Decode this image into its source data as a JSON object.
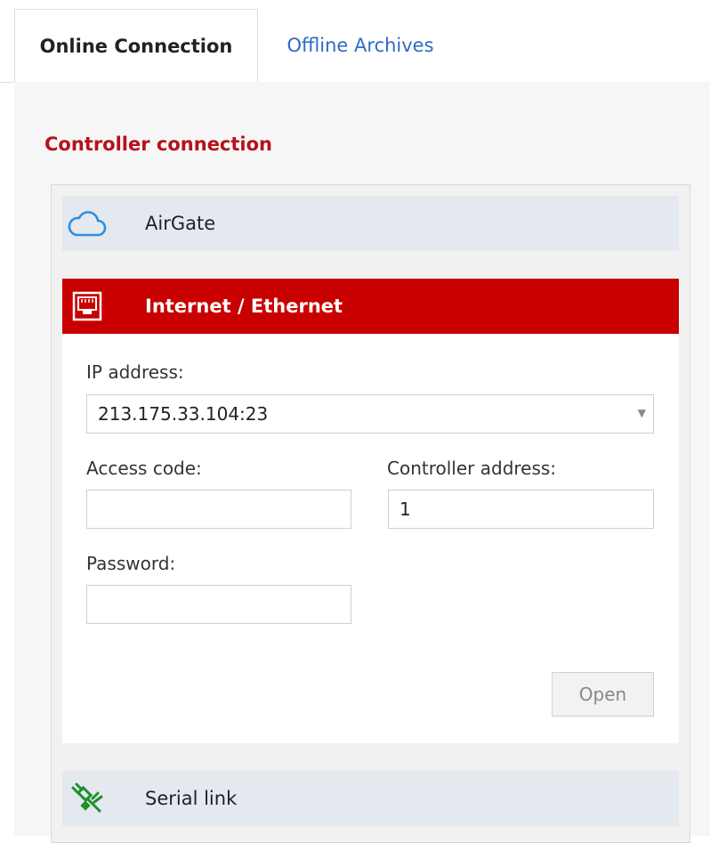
{
  "tabs": [
    {
      "label": "Online Connection",
      "active": true
    },
    {
      "label": "Offline Archives",
      "active": false
    }
  ],
  "section_title": "Controller connection",
  "accordion": {
    "airgate": {
      "label": "AirGate",
      "icon": "cloud-icon"
    },
    "internet": {
      "label": "Internet / Ethernet",
      "icon": "ethernet-port-icon",
      "expanded": true
    },
    "serial": {
      "label": "Serial link",
      "icon": "serial-cable-icon"
    }
  },
  "form": {
    "ip_address_label": "IP address:",
    "ip_address_value": "213.175.33.104:23",
    "access_code_label": "Access code:",
    "access_code_value": "",
    "controller_address_label": "Controller address:",
    "controller_address_value": "1",
    "password_label": "Password:",
    "password_value": "",
    "open_button": "Open"
  },
  "colors": {
    "accent_red": "#c90000",
    "title_red": "#b5121b",
    "link_blue": "#2e6bc6",
    "header_bg": "#e4e9f0"
  }
}
